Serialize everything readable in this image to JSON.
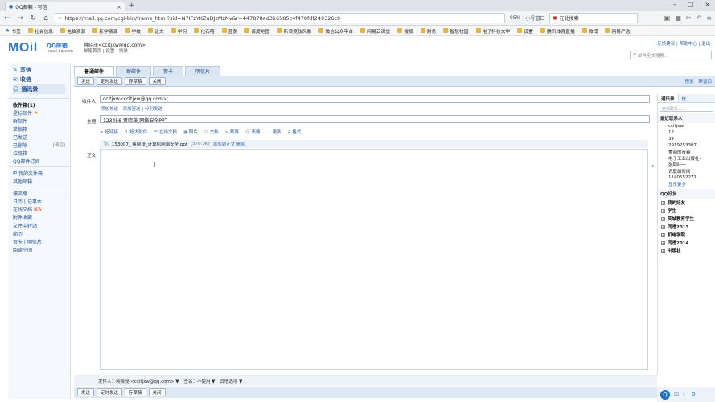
{
  "browser": {
    "tab_title": "QQ邮箱 - 写信",
    "url": "https://mail.qq.com/cgi-bin/frame_html?sid=N7IFzYKZuDJzMzNv&r=447878ad316585c4f478fdf249326c9",
    "zoom": "95%",
    "small_window": "小号窗口",
    "search_placeholder": "在此搜索"
  },
  "bookmarks": [
    "书签",
    "社会信息",
    "电脑资源",
    "新学资源",
    "学校",
    "论文",
    "学习",
    "化石嘻",
    "蓝黄",
    "百度地图",
    "新浪竞技风暴",
    "微信公众平台",
    "网易云课堂",
    "搜狐",
    "财务",
    "智慧校园",
    "电子科技大学",
    "设置",
    "腾讯体育直播",
    "微博",
    "网易严选"
  ],
  "mail_header": {
    "logo": "MOil",
    "logo_sub": "QQ邮箱",
    "logo_domain": "mail.qq.com",
    "user": "蒋晓茂<ccitjxw@qq.com>",
    "user_links": "邮箱首页 | 设置 - 换肤",
    "top_links": "| 反馈建议 | 帮助中心 | 退出",
    "search_placeholder": "邮件全文搜索..."
  },
  "leftnav": {
    "primary": [
      {
        "icon": "pencil-icon",
        "label": "写信"
      },
      {
        "icon": "inbox-icon",
        "label": "收信"
      },
      {
        "icon": "contacts-icon",
        "label": "通讯录"
      }
    ],
    "folders": [
      {
        "label": "收件箱(1)",
        "bold": true
      },
      {
        "label": "星标邮件",
        "star": true
      },
      {
        "label": "群邮件"
      },
      {
        "label": "草稿箱"
      },
      {
        "label": "已发送"
      },
      {
        "label": "已删除",
        "count": "[清空]"
      },
      {
        "label": "垃圾箱"
      },
      {
        "label": "QQ邮件订阅"
      }
    ],
    "my_folders": "我的文件夹",
    "other_mailbox": "其他邮箱",
    "extras": [
      {
        "label": "漂流瓶"
      },
      {
        "label": "日历 | 记事本"
      },
      {
        "label": "在线文档",
        "badge": "NEW"
      },
      {
        "label": "附件收藏"
      },
      {
        "label": "文件中转站"
      },
      {
        "label": "简历"
      },
      {
        "label": "贺卡 | 明信片"
      },
      {
        "label": "阅读空间"
      }
    ]
  },
  "compose_tabs": [
    "普通邮件",
    "群邮件",
    "贺卡",
    "明信片"
  ],
  "toolbar": {
    "send": "发送",
    "scheduled": "定时发送",
    "save_draft": "存草稿",
    "close": "关闭",
    "right_links": [
      "预览",
      "新窗口"
    ]
  },
  "form": {
    "to_label": "收件人",
    "to_value": "ccitjxw<ccitjxw@qq.com>;",
    "to_links": "添加抄送 - 添加密送 | 分别发送",
    "subject_label": "主题",
    "subject_value": "123456-蒋晓茂-网络安全PPT",
    "tools": [
      "超链接",
      "超大附件",
      "在线文档",
      "照片",
      "文档",
      "截屏",
      "表情",
      "更多",
      "格式"
    ],
    "attachment_name": "153007_ 蒋晓茂_计算机网络安全.ppt",
    "attachment_size": "(570.0K)",
    "attachment_actions": "添加到正文 删除",
    "body_label": "正文",
    "cursor": "I"
  },
  "contacts": {
    "tabs": [
      "通讯录",
      "信"
    ],
    "search_placeholder": "查找联系人...",
    "recent_label": "最近联系人",
    "recent": [
      "ccitjxw",
      "12",
      "34",
      "2919253307",
      "美丽的青春",
      "电子工业出版社-",
      "张阿叶一",
      "讯联络时间",
      "1140552271"
    ],
    "more": "显示更多",
    "qq_friends": "QQ好友",
    "groups": [
      "我的好友",
      "学生",
      "英城教育学生",
      "同透2013",
      "机电学院",
      "同透2014",
      "出版社"
    ]
  },
  "bottom": {
    "sender_label": "发件人：蒋晓茂 <ccitjxw@qq.com> ▼",
    "sign_label": "签名：不使用 ▼",
    "other_options": "其他选项 ▼"
  },
  "tray": [
    "Q",
    "中",
    "☾",
    "⚙"
  ]
}
